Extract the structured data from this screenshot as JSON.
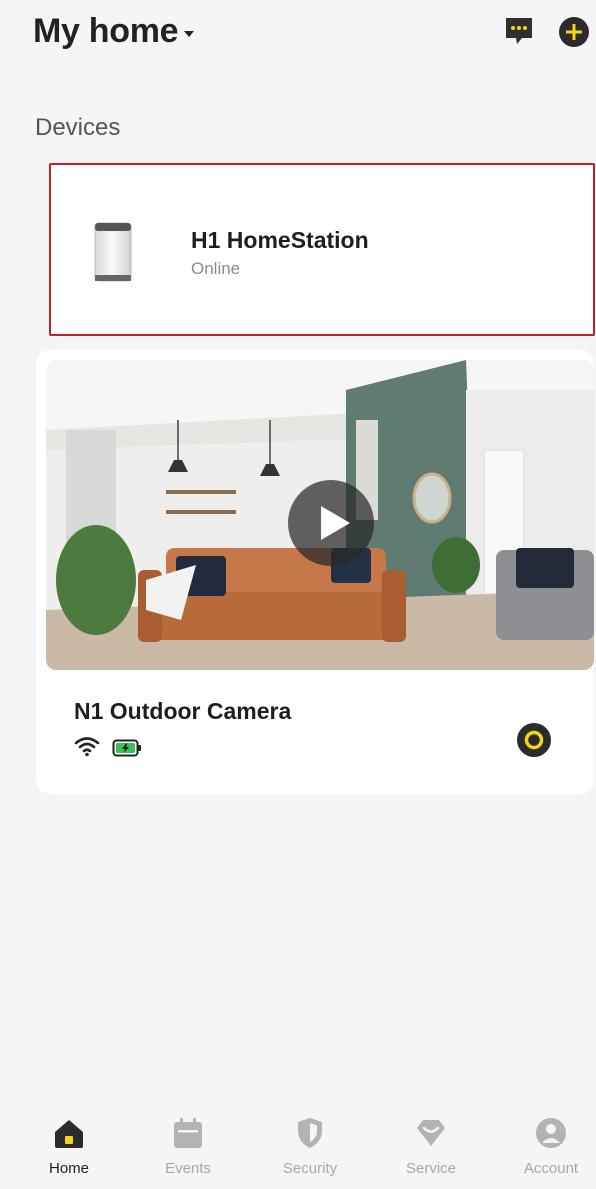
{
  "header": {
    "title": "My home",
    "icons": {
      "switcher": "caret-down-icon",
      "messages": "chat-bubble-icon",
      "add": "plus-circle-icon"
    }
  },
  "devices": {
    "section_title": "Devices",
    "items": [
      {
        "name": "H1 HomeStation",
        "status": "Online",
        "icon": "homestation-hub-icon",
        "highlighted": true
      },
      {
        "name": "N1 Outdoor Camera",
        "preview": "living-room-camera-preview",
        "icons": [
          "wifi-icon",
          "battery-charging-icon",
          "power-toggle-icon"
        ]
      }
    ]
  },
  "nav": {
    "items": [
      {
        "label": "Home",
        "icon": "home-icon",
        "active": true
      },
      {
        "label": "Events",
        "icon": "calendar-icon",
        "active": false
      },
      {
        "label": "Security",
        "icon": "shield-icon",
        "active": false
      },
      {
        "label": "Service",
        "icon": "gem-icon",
        "active": false
      },
      {
        "label": "Account",
        "icon": "account-icon",
        "active": false
      }
    ]
  },
  "colors": {
    "accent": "#f3d516",
    "selection_border": "#c4202a",
    "background": "#f5f5f5",
    "icon_dark": "#2b2b2b",
    "nav_inactive": "#b3b3b3"
  }
}
